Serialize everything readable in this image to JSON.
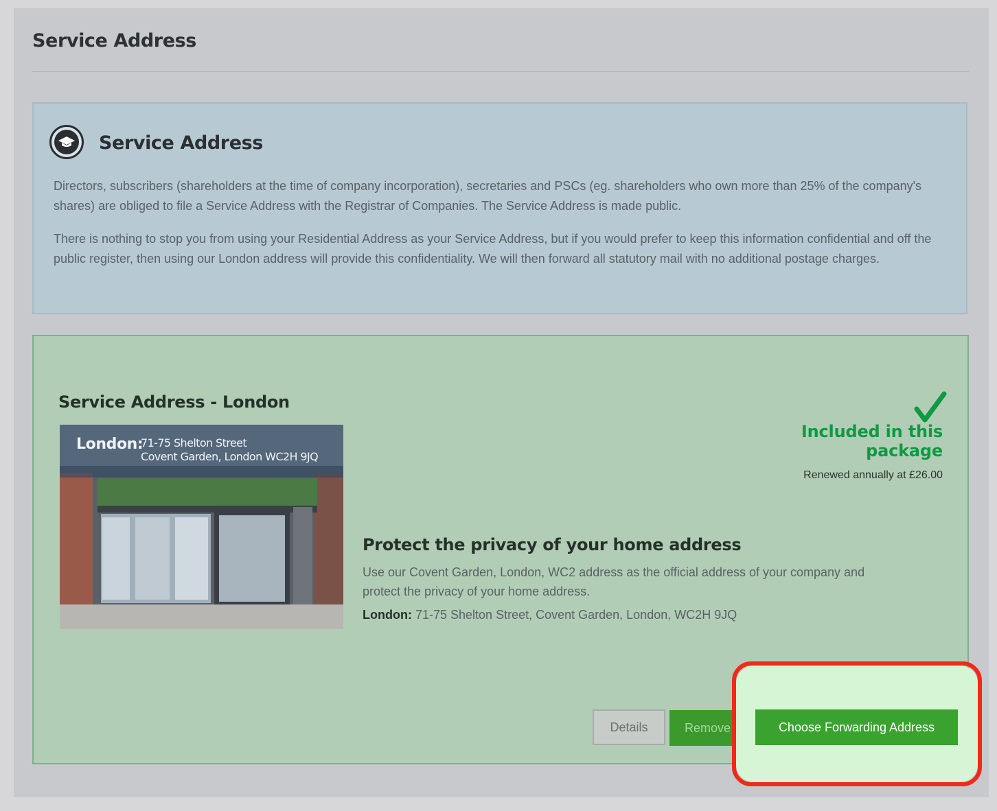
{
  "page": {
    "title": "Service Address"
  },
  "info": {
    "heading": "Service Address",
    "icon": "graduation-cap-icon",
    "paragraph1": "Directors, subscribers (shareholders at the time of company incorporation), secretaries and PSCs (eg. shareholders who own more than 25% of the company's shares) are obliged to file a Service Address with the Registrar of Companies. The Service Address is made public.",
    "paragraph2": "There is nothing to stop you from using your Residential Address as your Service Address, but if you would prefer to keep this information confidential and off the public register, then using our London address will provide this confidentiality. We will then forward all statutory mail with no additional postage charges."
  },
  "product": {
    "heading": "Service Address - London",
    "photo": {
      "city": "London:",
      "line1": "71-75 Shelton Street",
      "line2": "Covent Garden, London WC2H 9JQ"
    },
    "included_label": "Included in this package",
    "renewed_label": "Renewed annually at £26.00",
    "protect_heading": "Protect the privacy of your home address",
    "protect_text": "Use our Covent Garden, London, WC2 address as the official address of your company and protect the privacy of your home address.",
    "address_label": "London:",
    "address_value": "71-75 Shelton Street, Covent Garden, London, WC2H 9JQ"
  },
  "buttons": {
    "details": "Details",
    "remove": "Remove",
    "forward": "Choose Forwarding Address"
  },
  "colors": {
    "info_panel": "#b7c9d3",
    "product_panel": "#b1cdb6",
    "accent_green": "#0d9a42",
    "button_green": "#3aa32f",
    "highlight_red": "#ee2a1a"
  }
}
